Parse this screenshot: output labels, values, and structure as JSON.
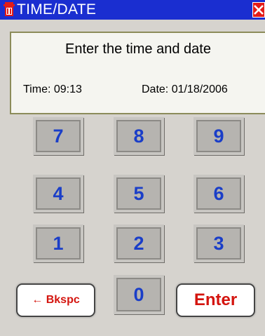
{
  "window": {
    "title": "TIME/DATE",
    "close_icon": "close-icon",
    "app_icon": "trash-can-icon"
  },
  "panel": {
    "prompt": "Enter the time and date",
    "time_readout": "Time: 09:13",
    "date_readout": "Date: 01/18/2006"
  },
  "keypad": {
    "keys": [
      "7",
      "8",
      "9",
      "4",
      "5",
      "6",
      "1",
      "2",
      "3",
      "0"
    ],
    "backspace_label": "← Bkspc",
    "enter_label": "Enter"
  },
  "colors": {
    "titlebar": "#1a2ed0",
    "digit": "#1a3ec8",
    "action_text": "#d4140e",
    "close": "#e31b17"
  }
}
